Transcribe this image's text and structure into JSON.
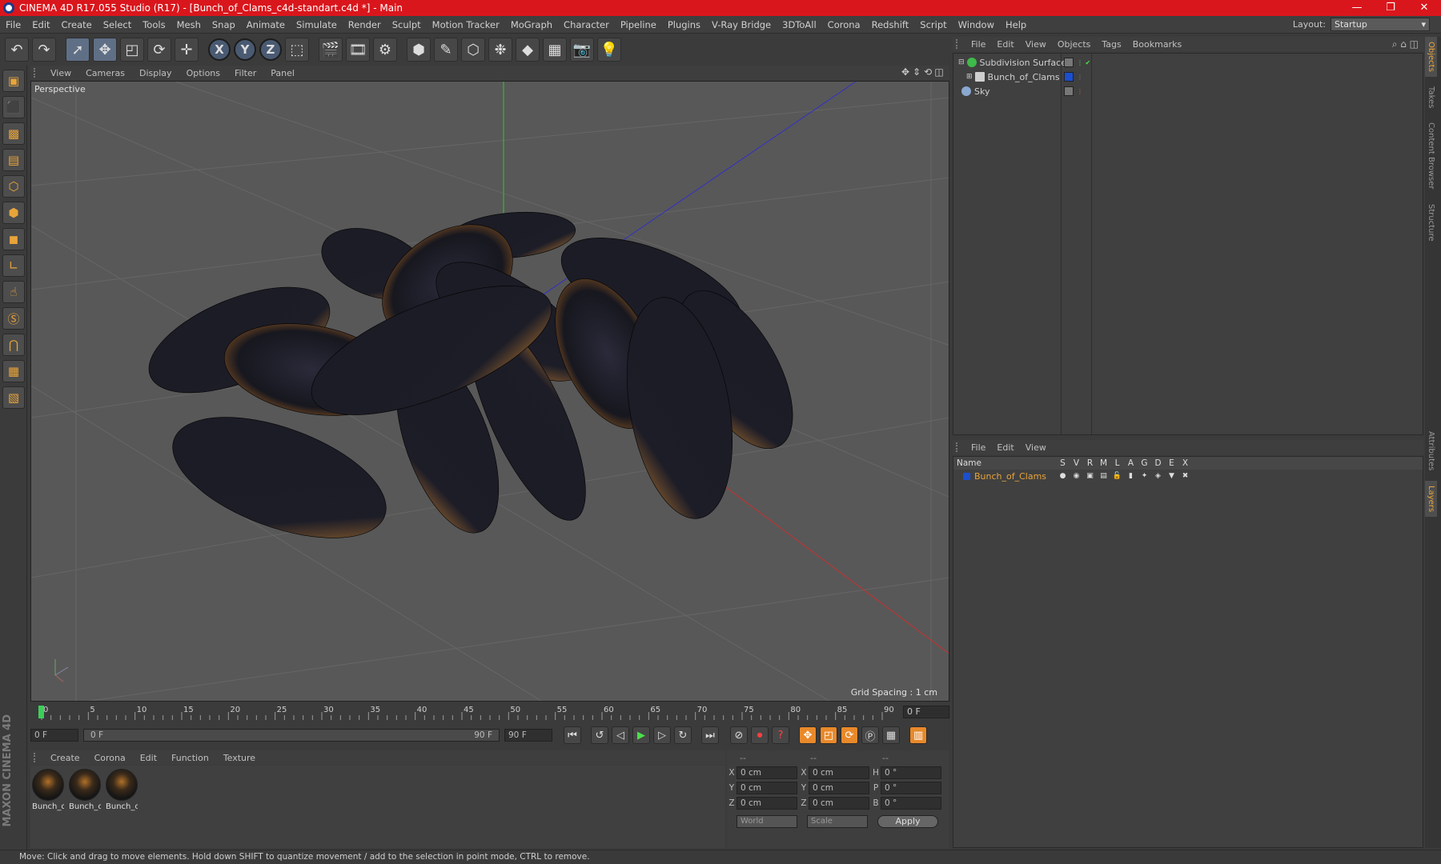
{
  "window": {
    "title": "CINEMA 4D R17.055 Studio (R17) - [Bunch_of_Clams_c4d-standart.c4d *] - Main",
    "controls": [
      "—",
      "❐",
      "✕"
    ]
  },
  "menubar": {
    "items": [
      "File",
      "Edit",
      "Create",
      "Select",
      "Tools",
      "Mesh",
      "Snap",
      "Animate",
      "Simulate",
      "Render",
      "Sculpt",
      "Motion Tracker",
      "MoGraph",
      "Character",
      "Pipeline",
      "Plugins",
      "V-Ray Bridge",
      "3DToAll",
      "Corona",
      "Redshift",
      "Script",
      "Window",
      "Help"
    ],
    "layout_label": "Layout:",
    "layout_value": "Startup"
  },
  "toolbar": {
    "axis_x": "X",
    "axis_y": "Y",
    "axis_z": "Z"
  },
  "viewport": {
    "menu": [
      "View",
      "Cameras",
      "Display",
      "Options",
      "Filter",
      "Panel"
    ],
    "label": "Perspective",
    "grid_spacing": "Grid Spacing : 1 cm"
  },
  "timeline": {
    "ticks": [
      "0",
      "5",
      "10",
      "15",
      "20",
      "25",
      "30",
      "35",
      "40",
      "45",
      "50",
      "55",
      "60",
      "65",
      "70",
      "75",
      "80",
      "85",
      "90"
    ],
    "current_frame": "0 F",
    "start_field": "0 F",
    "slider_start": "0 F",
    "slider_end": "90 F",
    "end_field": "90 F"
  },
  "materials": {
    "menu": [
      "Create",
      "Corona",
      "Edit",
      "Function",
      "Texture"
    ],
    "items": [
      {
        "name": "Bunch_c"
      },
      {
        "name": "Bunch_c"
      },
      {
        "name": "Bunch_c"
      }
    ]
  },
  "coords": {
    "headers": [
      "--",
      "--",
      "--"
    ],
    "rows": [
      {
        "l1": "X",
        "v1": "0 cm",
        "l2": "X",
        "v2": "0 cm",
        "l3": "H",
        "v3": "0 °"
      },
      {
        "l1": "Y",
        "v1": "0 cm",
        "l2": "Y",
        "v2": "0 cm",
        "l3": "P",
        "v3": "0 °"
      },
      {
        "l1": "Z",
        "v1": "0 cm",
        "l2": "Z",
        "v2": "0 cm",
        "l3": "B",
        "v3": "0 °"
      }
    ],
    "world": "World",
    "scale": "Scale",
    "apply": "Apply"
  },
  "object_manager": {
    "menu": [
      "File",
      "Edit",
      "View",
      "Objects",
      "Tags",
      "Bookmarks"
    ],
    "objects": [
      {
        "name": "Subdivision Surface",
        "icon_color": "#3fb94a"
      },
      {
        "name": "Bunch_of_Clams",
        "icon_color": "#cfcfcf"
      },
      {
        "name": "Sky",
        "icon_color": "#8aa8d0"
      }
    ]
  },
  "layer_manager": {
    "menu": [
      "File",
      "Edit",
      "View"
    ],
    "columns": [
      "Name",
      "S",
      "V",
      "R",
      "M",
      "L",
      "A",
      "G",
      "D",
      "E",
      "X"
    ],
    "layers": [
      {
        "name": "Bunch_of_Clams",
        "color": "#1a4fd0"
      }
    ]
  },
  "side_tabs": [
    "Objects",
    "Takes",
    "Content Browser",
    "Structure",
    "Attributes",
    "Layers"
  ],
  "status": "Move: Click and drag to move elements. Hold down SHIFT to quantize movement / add to the selection in point mode, CTRL to remove."
}
